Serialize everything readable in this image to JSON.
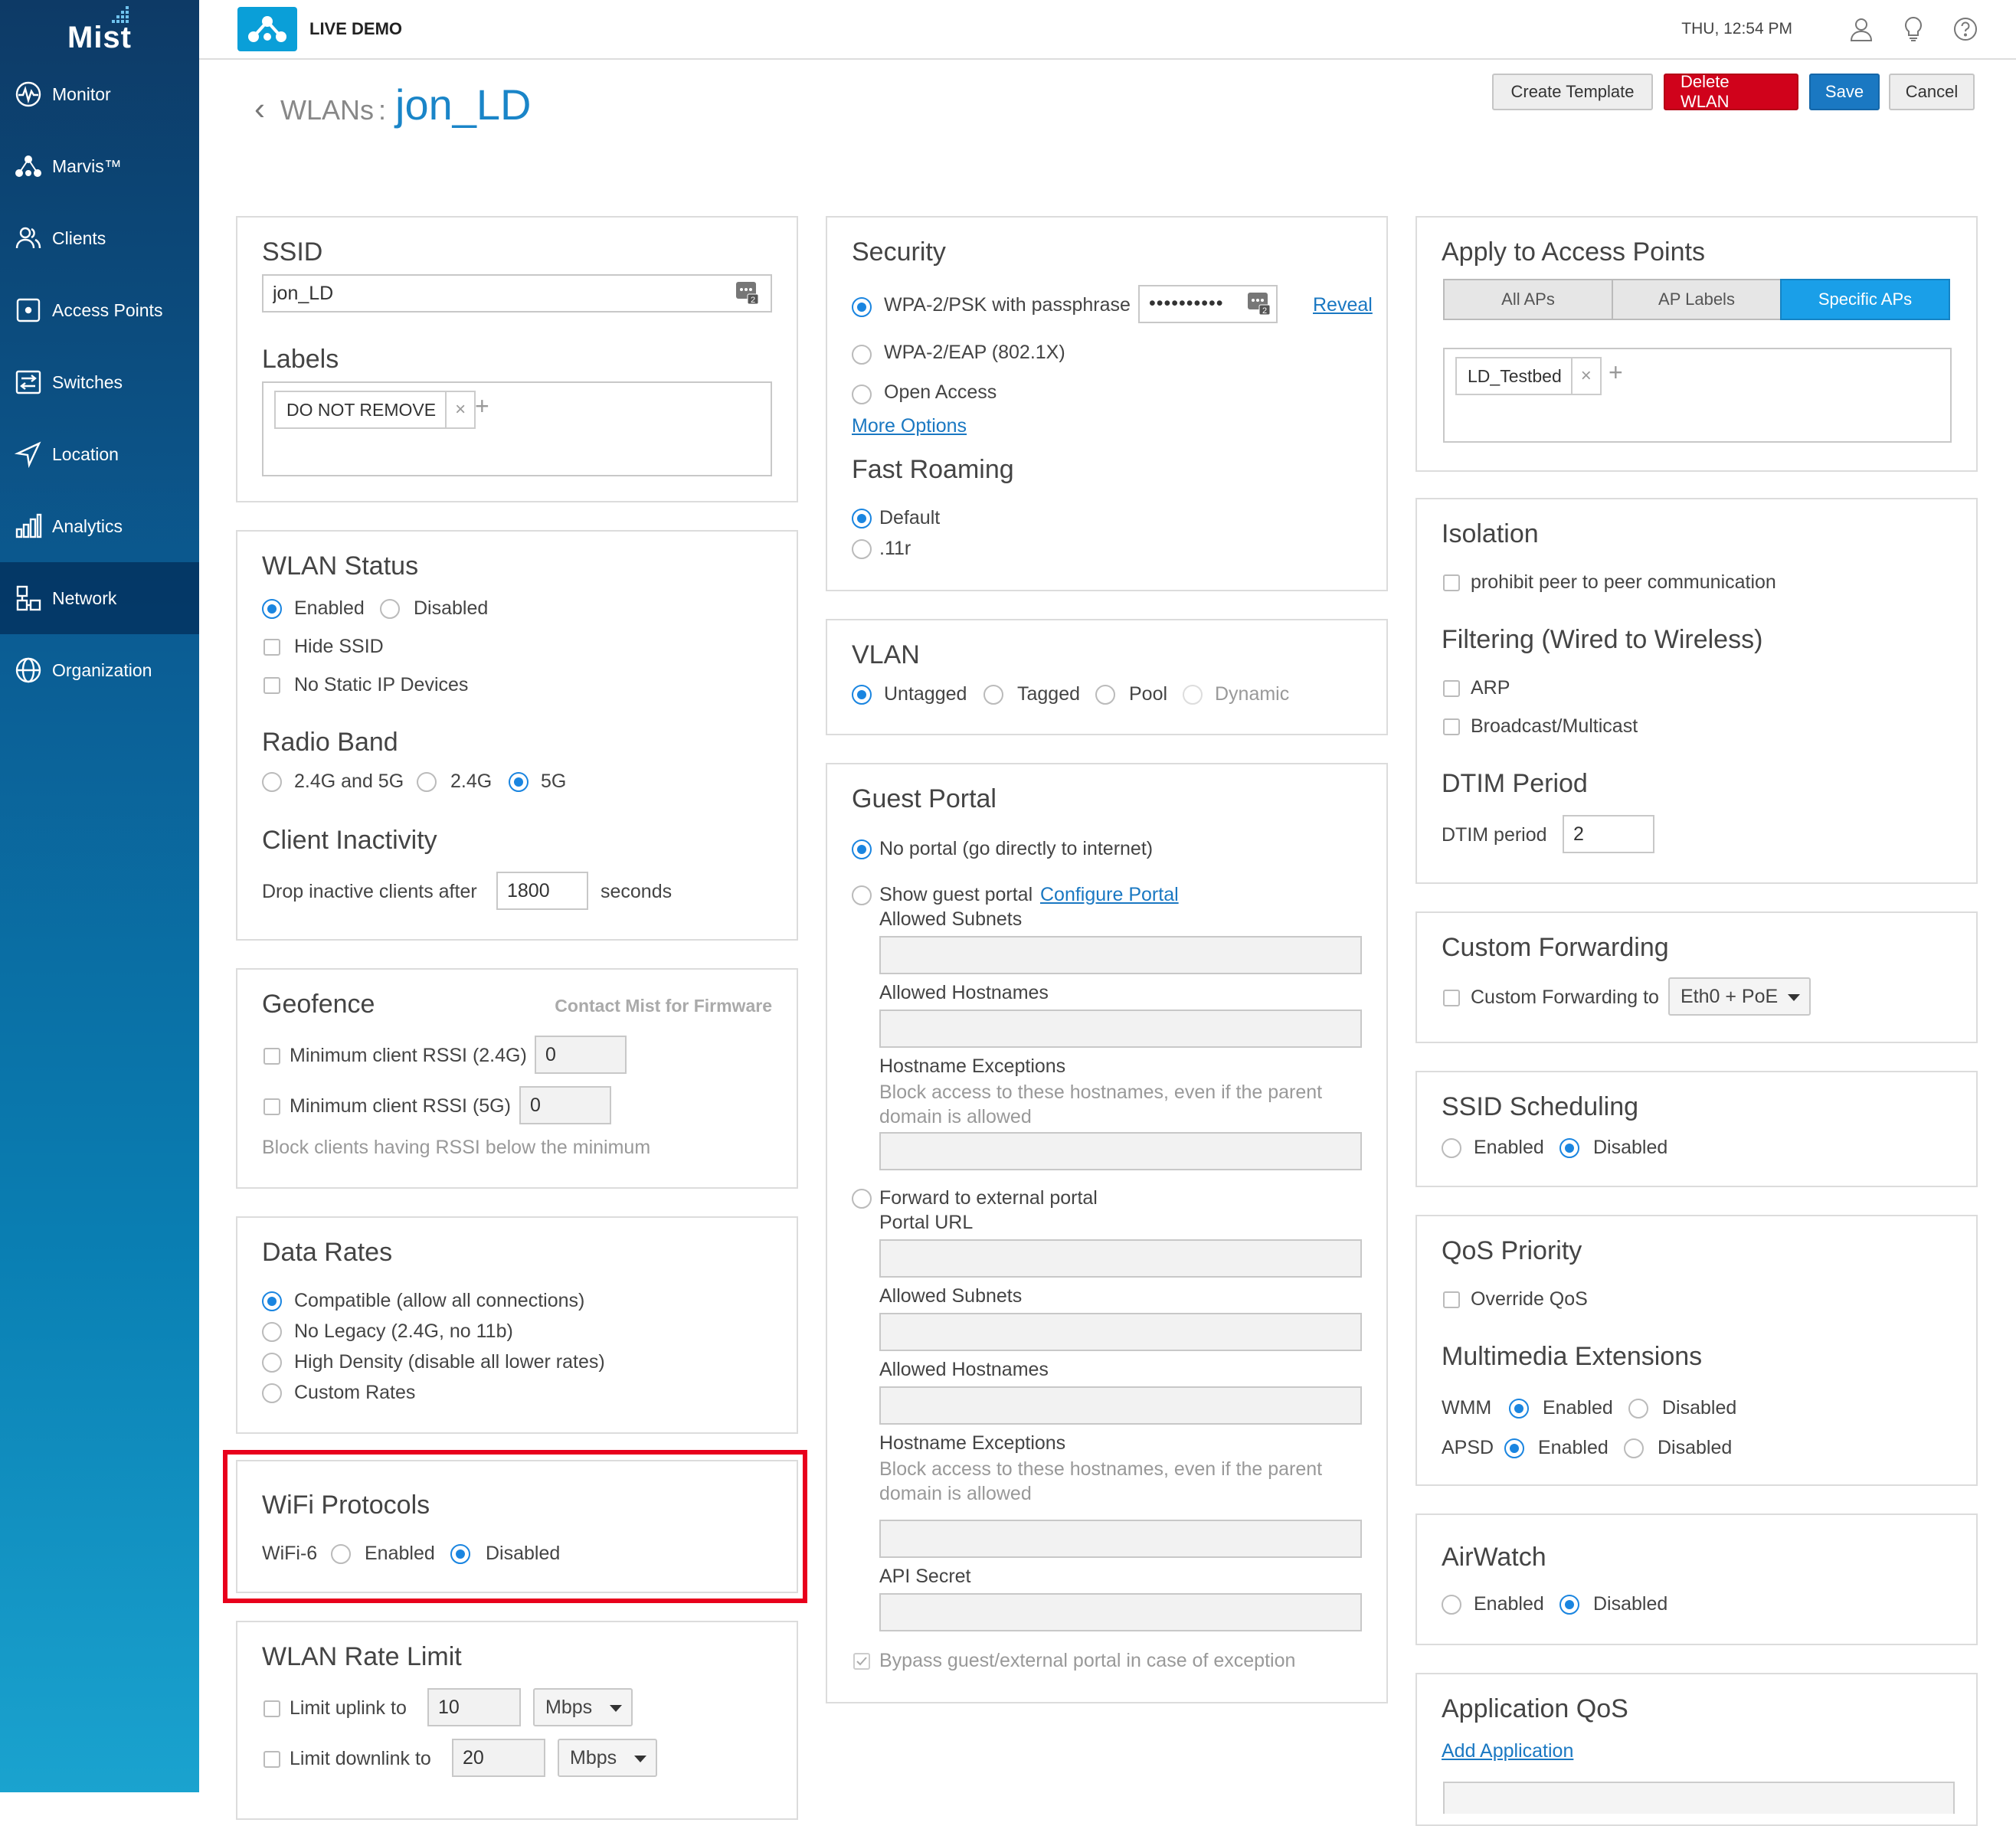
{
  "sidebar": {
    "logo": "Mist",
    "items": [
      {
        "label": "Monitor",
        "icon": "monitor-icon"
      },
      {
        "label": "Marvis™",
        "icon": "marvis-icon"
      },
      {
        "label": "Clients",
        "icon": "clients-icon"
      },
      {
        "label": "Access Points",
        "icon": "access-point-icon"
      },
      {
        "label": "Switches",
        "icon": "switch-icon"
      },
      {
        "label": "Location",
        "icon": "location-icon"
      },
      {
        "label": "Analytics",
        "icon": "analytics-icon"
      },
      {
        "label": "Network",
        "icon": "network-icon"
      },
      {
        "label": "Organization",
        "icon": "organization-icon"
      }
    ],
    "active": "Network"
  },
  "topbar": {
    "org_name": "LIVE DEMO",
    "clock": "THU, 12:54 PM",
    "icons": [
      "user-icon",
      "lightbulb-icon",
      "help-icon"
    ]
  },
  "header": {
    "parent": "WLANs",
    "separator": ":",
    "title": "jon_LD",
    "buttons": {
      "create_template": "Create Template",
      "delete": "Delete WLAN",
      "save": "Save",
      "cancel": "Cancel"
    }
  },
  "ssid": {
    "heading": "SSID",
    "value": "jon_LD",
    "labels_heading": "Labels",
    "label_tag": "DO NOT REMOVE"
  },
  "wlan_status": {
    "heading": "WLAN Status",
    "enabled": "Enabled",
    "disabled": "Disabled",
    "selected": "Enabled",
    "hide_ssid": "Hide SSID",
    "no_static_ip": "No Static IP Devices",
    "radio_band_heading": "Radio Band",
    "band_both": "2.4G and 5G",
    "band_24": "2.4G",
    "band_5": "5G",
    "band_selected": "5G",
    "inactivity_heading": "Client Inactivity",
    "drop_label": "Drop inactive clients after",
    "drop_value": "1800",
    "seconds": "seconds"
  },
  "geofence": {
    "heading": "Geofence",
    "contact": "Contact Mist for Firmware",
    "rssi24_label": "Minimum client RSSI (2.4G)",
    "rssi24_value": "0",
    "rssi5_label": "Minimum client RSSI (5G)",
    "rssi5_value": "0",
    "hint": "Block clients having RSSI below the minimum"
  },
  "data_rates": {
    "heading": "Data Rates",
    "options": [
      "Compatible (allow all connections)",
      "No Legacy (2.4G, no 11b)",
      "High Density (disable all lower rates)",
      "Custom Rates"
    ],
    "selected": "Compatible (allow all connections)"
  },
  "wifi_protocols": {
    "heading": "WiFi Protocols",
    "wifi6": "WiFi-6",
    "enabled": "Enabled",
    "disabled": "Disabled",
    "selected": "Disabled"
  },
  "rate_limit": {
    "heading": "WLAN Rate Limit",
    "uplink_label": "Limit uplink to",
    "uplink_value": "10",
    "uplink_unit": "Mbps",
    "downlink_label": "Limit downlink to",
    "downlink_value": "20",
    "downlink_unit": "Mbps"
  },
  "security": {
    "heading": "Security",
    "wpa2_psk": "WPA-2/PSK with passphrase",
    "passphrase": "••••••••••",
    "reveal": "Reveal",
    "wpa2_eap": "WPA-2/EAP (802.1X)",
    "open": "Open Access",
    "more": "More Options",
    "selected": "WPA-2/PSK with passphrase",
    "fast_roaming_heading": "Fast Roaming",
    "fr_default": "Default",
    "fr_11r": ".11r",
    "fr_selected": "Default"
  },
  "vlan": {
    "heading": "VLAN",
    "untagged": "Untagged",
    "tagged": "Tagged",
    "pool": "Pool",
    "dynamic": "Dynamic",
    "selected": "Untagged"
  },
  "guest_portal": {
    "heading": "Guest Portal",
    "no_portal": "No portal (go directly to internet)",
    "show_portal": "Show guest portal",
    "configure": "Configure Portal",
    "allowed_subnets": "Allowed Subnets",
    "allowed_hostnames": "Allowed Hostnames",
    "hostname_exceptions": "Hostname Exceptions",
    "exceptions_hint": "Block access to these hostnames, even if the parent domain is allowed",
    "forward": "Forward to external portal",
    "portal_url": "Portal URL",
    "allowed_subnets2": "Allowed Subnets",
    "allowed_hostnames2": "Allowed Hostnames",
    "hostname_exceptions2": "Hostname Exceptions",
    "exceptions_hint2": "Block access to these hostnames, even if the parent domain is allowed",
    "api_secret": "API Secret",
    "bypass": "Bypass guest/external portal in case of exception",
    "selected": "No portal (go directly to internet)"
  },
  "apply_aps": {
    "heading": "Apply to Access Points",
    "tabs": [
      "All APs",
      "AP Labels",
      "Specific APs"
    ],
    "active_tab": "Specific APs",
    "tag": "LD_Testbed"
  },
  "isolation": {
    "heading": "Isolation",
    "prohibit": "prohibit peer to peer communication",
    "filtering_heading": "Filtering (Wired to Wireless)",
    "arp": "ARP",
    "broadcast": "Broadcast/Multicast",
    "dtim_heading": "DTIM Period",
    "dtim_label": "DTIM period",
    "dtim_value": "2"
  },
  "custom_forwarding": {
    "heading": "Custom Forwarding",
    "label": "Custom Forwarding to",
    "value": "Eth0 + PoE"
  },
  "ssid_scheduling": {
    "heading": "SSID Scheduling",
    "enabled": "Enabled",
    "disabled": "Disabled",
    "selected": "Disabled"
  },
  "qos": {
    "heading": "QoS Priority",
    "override": "Override QoS",
    "wmm_heading": "Multimedia Extensions",
    "wmm": "WMM",
    "apsd": "APSD",
    "enabled": "Enabled",
    "disabled": "Disabled",
    "wmm_selected": "Enabled",
    "apsd_selected": "Enabled"
  },
  "airwatch": {
    "heading": "AirWatch",
    "enabled": "Enabled",
    "disabled": "Disabled",
    "selected": "Disabled"
  },
  "app_qos": {
    "heading": "Application QoS",
    "add": "Add Application"
  },
  "colors": {
    "accent": "#1a85e0",
    "delete": "#d0021b",
    "save": "#1a78c2",
    "highlight": "#e8001c"
  }
}
